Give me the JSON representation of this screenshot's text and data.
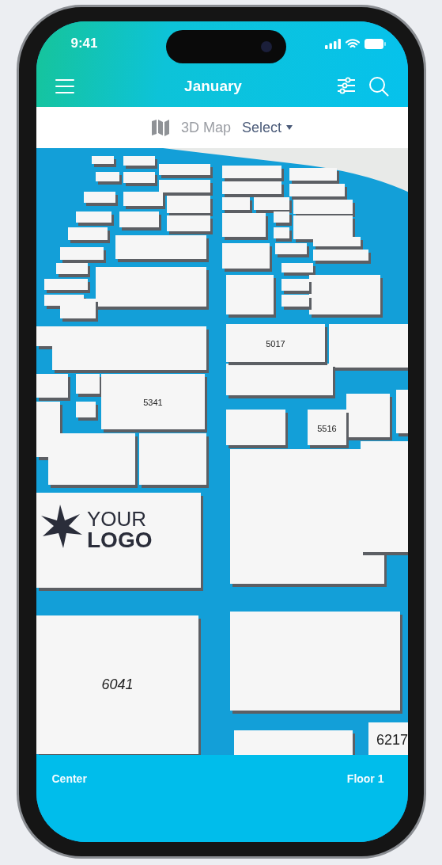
{
  "status_bar": {
    "time": "9:41"
  },
  "header": {
    "title": "January"
  },
  "view_selector": {
    "label": "3D Map",
    "action": "Select"
  },
  "map": {
    "booths": [
      {
        "label": "5017"
      },
      {
        "label": "5341"
      },
      {
        "label": "5516"
      },
      {
        "label": "6041"
      },
      {
        "label": "6217"
      }
    ],
    "logo": {
      "lines": [
        "YOUR",
        "LOGO"
      ]
    }
  },
  "bottom_bar": {
    "left": "Center",
    "right": "Floor 1"
  }
}
